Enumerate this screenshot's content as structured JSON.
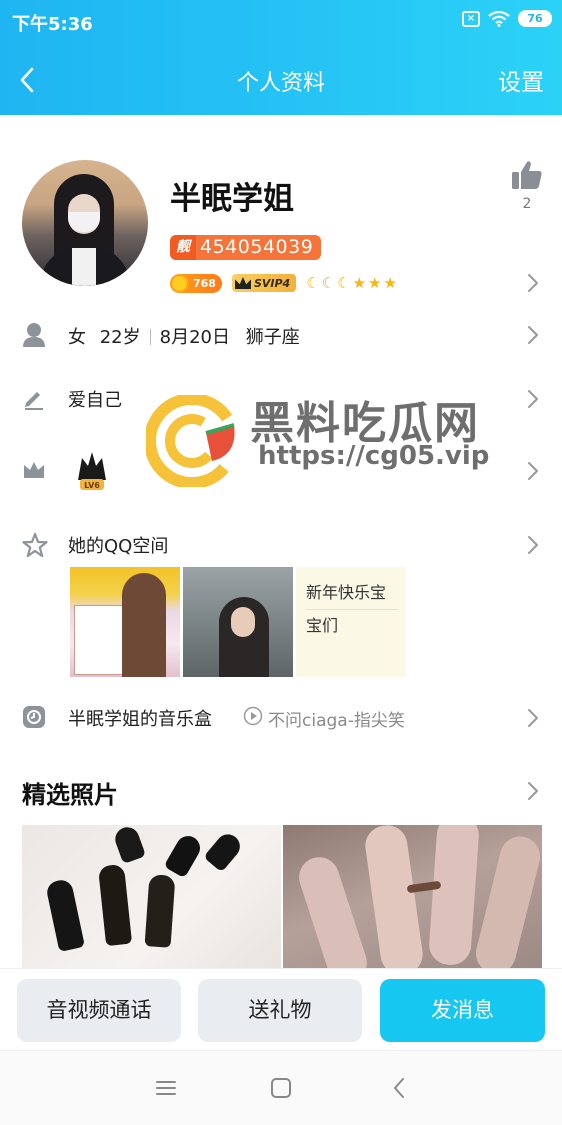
{
  "status_bar": {
    "time": "下午5:36",
    "battery": "76"
  },
  "navbar": {
    "title": "个人资料",
    "settings_label": "设置"
  },
  "profile": {
    "nickname": "半眠学姐",
    "likes": "2",
    "qq_tag": "靓",
    "qq_number": "454054039",
    "level": "768",
    "vip": "SVIP4",
    "rank_icons": [
      "moon",
      "moon",
      "moon",
      "star",
      "star",
      "star"
    ]
  },
  "info_row": {
    "gender": "女",
    "age": "22岁",
    "birthday": "8月20日",
    "zodiac": "狮子座"
  },
  "signature": "爱自己",
  "vip_level_label": "LV6",
  "qzone": {
    "title": "她的QQ空间",
    "text_card": [
      "新年快乐宝",
      "宝们"
    ]
  },
  "music": {
    "title": "半眠学姐的音乐盒",
    "song": "不问ciaga-指尖笑"
  },
  "featured": {
    "title": "精选照片"
  },
  "actions": {
    "call": "音视频通话",
    "gift": "送礼物",
    "message": "发消息"
  },
  "watermark": {
    "name": "黑料吃瓜网",
    "url": "https://cg05.vip"
  },
  "colors": {
    "header": "#1fb5f2",
    "primary_button": "#16c7f2",
    "qq_badge": "#f6733a",
    "watermark_logo": "#f5c23a"
  }
}
